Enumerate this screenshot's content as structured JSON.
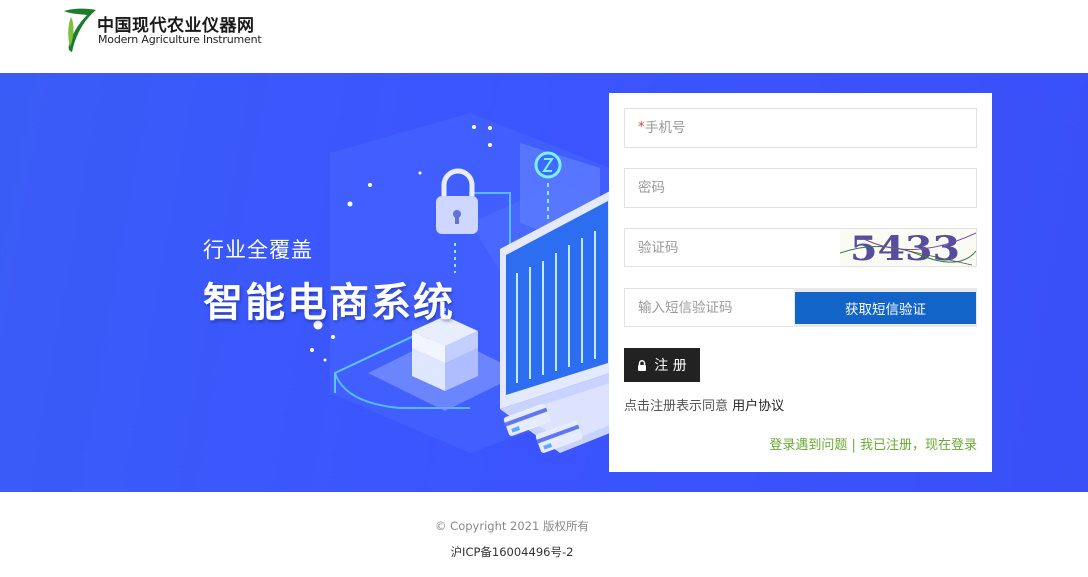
{
  "header": {
    "logo_cn": "中国现代农业仪器网",
    "logo_en": "Modern Agriculture Instrument"
  },
  "banner": {
    "slogan_small": "行业全覆盖",
    "slogan_big": "智能电商系统"
  },
  "form": {
    "phone": {
      "required_mark": "*",
      "placeholder": "手机号"
    },
    "password": {
      "placeholder": "密码"
    },
    "captcha": {
      "placeholder": "验证码",
      "image_text": "5433"
    },
    "sms_code": {
      "placeholder": "输入短信验证码"
    },
    "sms_button": "获取短信验证",
    "register_button": "注 册",
    "agree_text": "点击注册表示同意 ",
    "agree_link": "用户协议",
    "help_link": "登录遇到问题",
    "separator": " | ",
    "login_link": "我已注册，现在登录"
  },
  "footer": {
    "copyright": "© Copyright 2021 版权所有",
    "icp": "沪ICP备16004496号-2"
  },
  "colors": {
    "banner_blue": "#3b55ff",
    "sms_button": "#1264c8",
    "register_button": "#222222",
    "link_green": "#6aaa35"
  }
}
